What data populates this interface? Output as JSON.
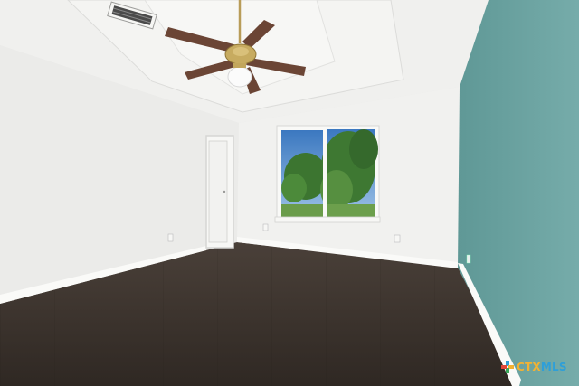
{
  "photo": {
    "subject": "empty-room",
    "colors": {
      "ceiling": "#f1f1ef",
      "left_wall": "#ebebe9",
      "back_wall": "#f0f0ee",
      "accent_wall": "#6fa5a3",
      "floor": "#3b332d",
      "window_sky": "#4a86c8",
      "window_trees": "#3f7a32",
      "fan_blade": "#6b4535",
      "fan_brass": "#bfa35a"
    }
  },
  "watermark": {
    "text_a": "CTX",
    "text_b": "MLS",
    "color_a": "#f2b233",
    "color_b": "#2f9fd8",
    "mark_colors": [
      "#2f9fd8",
      "#f2b233",
      "#3aa85a",
      "#e0463a"
    ]
  }
}
